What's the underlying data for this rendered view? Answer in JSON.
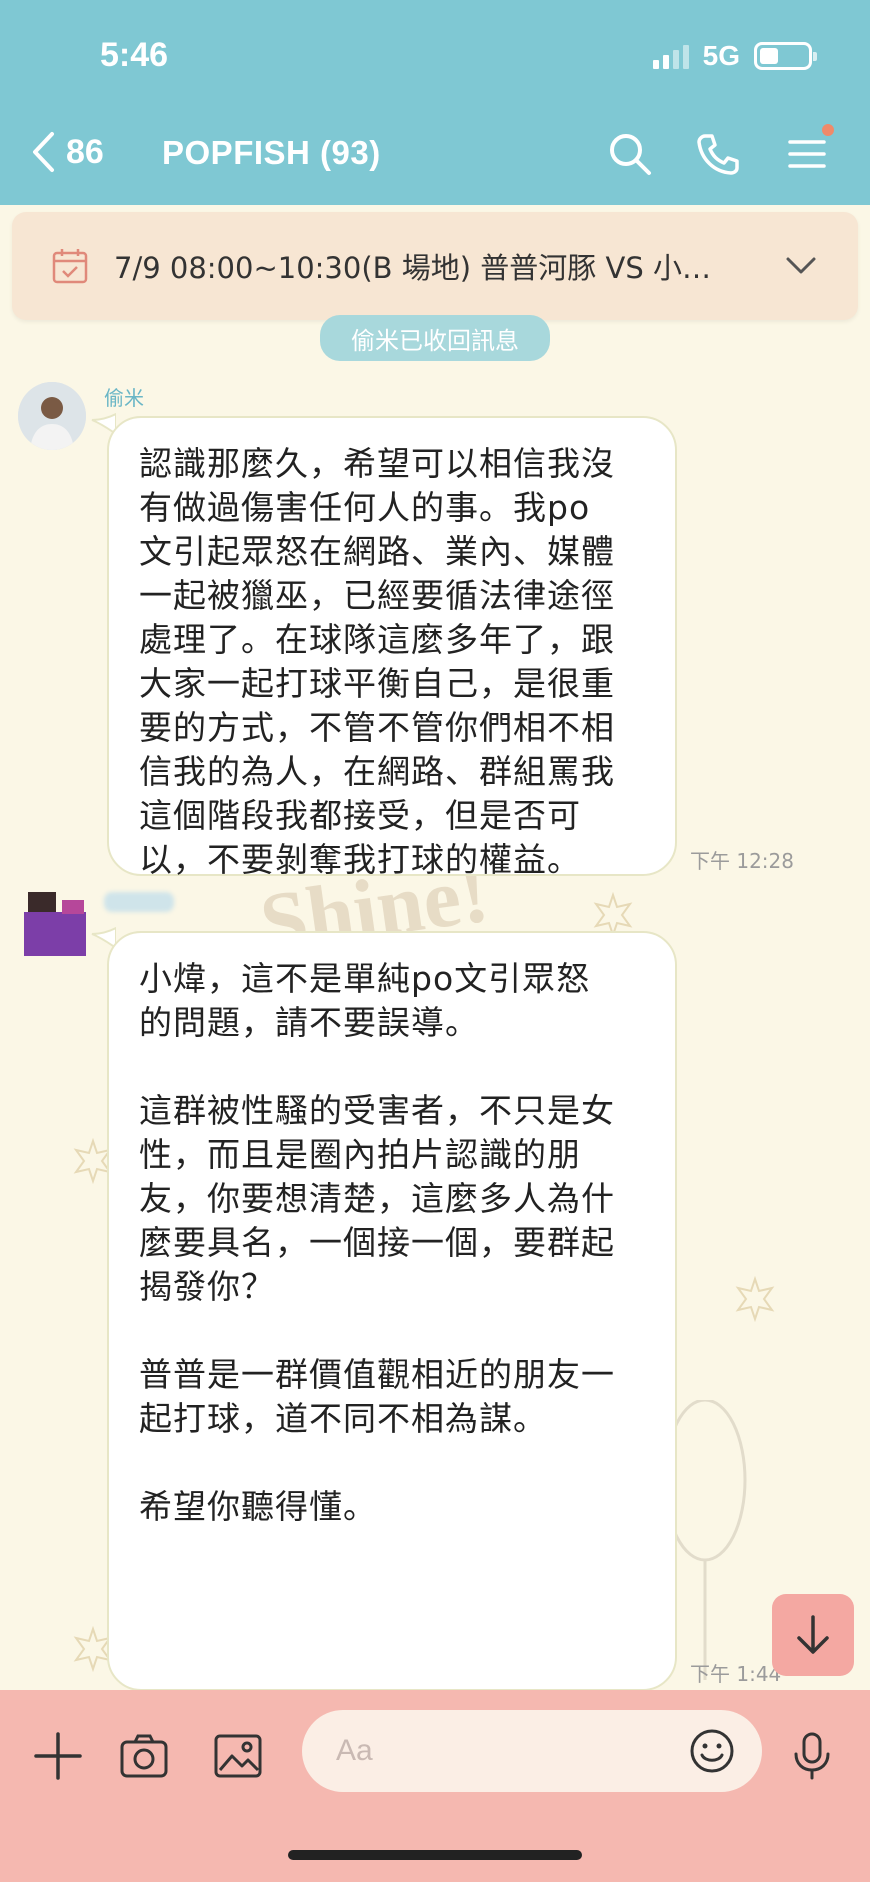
{
  "status_bar": {
    "time": "5:46",
    "network": "5G",
    "battery_level": 0.4
  },
  "nav": {
    "back_count": "86",
    "title": "POPFISH (93)",
    "icons": [
      "chevron-left-icon",
      "search-icon",
      "phone-icon",
      "menu-icon"
    ]
  },
  "announcement": {
    "text": "7/9   08:00~10:30(B 場地) 普普河豚 VS 小…"
  },
  "system": {
    "unsent_notice": "偷米已收回訊息"
  },
  "messages": [
    {
      "sender": "偷米",
      "text": "認識那麼久，希望可以相信我沒\n有做過傷害任何人的事。我po\n文引起眾怒在網路、業內、媒體\n一起被獵巫，已經要循法律途徑\n處理了。在球隊這麼多年了，跟\n大家一起打球平衡自己，是很重\n要的方式，不管不管你們相不相\n信我的為人，在網路、群組罵我\n這個階段我都接受，但是否可\n以，不要剝奪我打球的權益。",
      "time": "下午 12:28"
    },
    {
      "sender": "",
      "text": "小煒，這不是單純po文引眾怒\n的問題，請不要誤導。\n\n這群被性騷的受害者，不只是女\n性，而且是圈內拍片認識的朋\n友，你要想清楚，這麼多人為什\n麼要具名，一個接一個，要群起\n揭發你？\n\n普普是一群價值觀相近的朋友一\n起打球，道不同不相為謀。\n\n希望你聽得懂。",
      "time": "下午 1:44"
    }
  ],
  "background": {
    "sticker_text": "Shine!"
  },
  "composer": {
    "placeholder": "Aa"
  },
  "colors": {
    "header": "#7fc8d3",
    "chat_bg": "#fbf7e6",
    "announcement_bg": "#f7e6d3",
    "bottom_bar": "#f5b8b0",
    "sender_name": "#6ab6c6"
  }
}
